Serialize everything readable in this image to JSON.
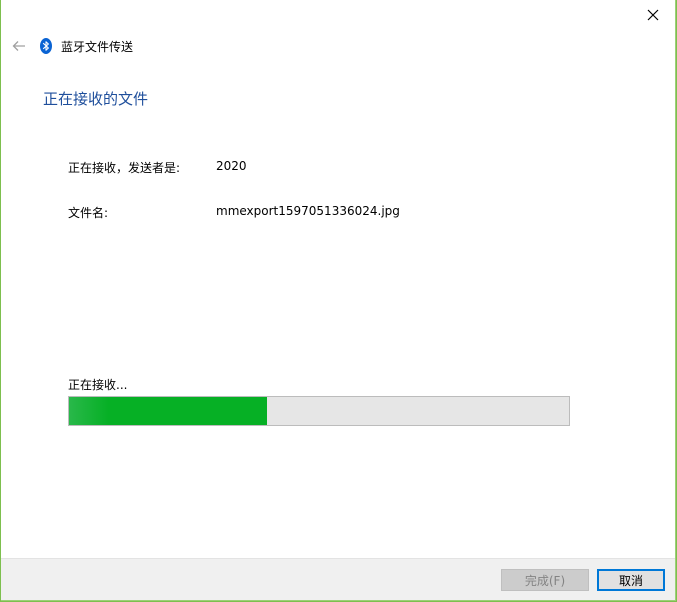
{
  "header": {
    "title": "蓝牙文件传送"
  },
  "main": {
    "page_title": "正在接收的文件",
    "sender_label": "正在接收，发送者是:",
    "sender_value": "2020",
    "filename_label": "文件名:",
    "filename_value": "mmexport1597051336024.jpg",
    "status_text": "正在接收..."
  },
  "progress": {
    "fraction": 0.395
  },
  "footer": {
    "done_label": "完成(F)",
    "cancel_label": "取消"
  },
  "colors": {
    "title_blue": "#1f4f9c",
    "progress_green": "#06b025",
    "accent_blue": "#0078d7"
  },
  "icons": {
    "back": "back-arrow-icon",
    "bluetooth": "bluetooth-icon",
    "close": "close-icon"
  }
}
